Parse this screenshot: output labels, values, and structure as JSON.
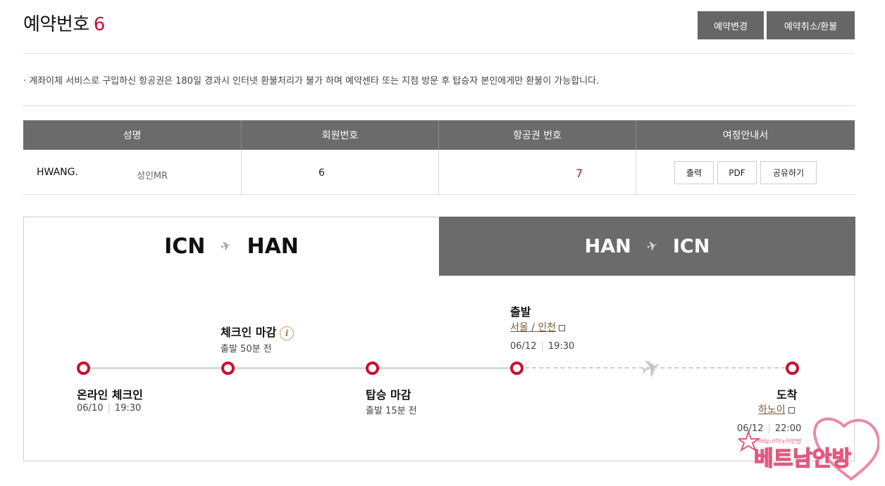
{
  "header": {
    "title": "예약번호",
    "number": "6",
    "btn_change": "예약변경",
    "btn_cancel": "예약취소/환불"
  },
  "notice": "· 계좌이체 서비스로 구입하신 항공권은 180일 경과시 인터넷 환불처리가 불가 하며 예약센타 또는 지점 방문 후 탑승자 본인에게만 환불이 가능합니다.",
  "table": {
    "headers": [
      "성명",
      "회원번호",
      "항공권 번호",
      "여정안내서"
    ],
    "name": "HWANG.",
    "name_type": "성인MR",
    "member_no": "6",
    "ticket_no": "7",
    "doc_buttons": [
      "출력",
      "PDF",
      "공유하기"
    ]
  },
  "tabs": {
    "active": {
      "from": "ICN",
      "to": "HAN"
    },
    "inactive": {
      "from": "HAN",
      "to": "ICN"
    }
  },
  "timeline": {
    "online_checkin": {
      "title": "온라인 체크인",
      "date": "06/10",
      "time": "19:30"
    },
    "checkin_close": {
      "title": "체크인 마감",
      "sub": "출발 50분 전"
    },
    "boarding_close": {
      "title": "탑승 마감",
      "sub": "출발 15분 전"
    },
    "departure": {
      "title": "출발",
      "place": "서울 / 인천",
      "date": "06/12",
      "time": "19:30"
    },
    "arrival": {
      "title": "도착",
      "place": "하노이",
      "date": "06/12",
      "time": "22:00"
    }
  },
  "watermark": {
    "text": "베트남안방",
    "small": "http://하노이안방"
  },
  "colors": {
    "accent": "#c8102e",
    "gray_dark": "#6b6b6b"
  }
}
